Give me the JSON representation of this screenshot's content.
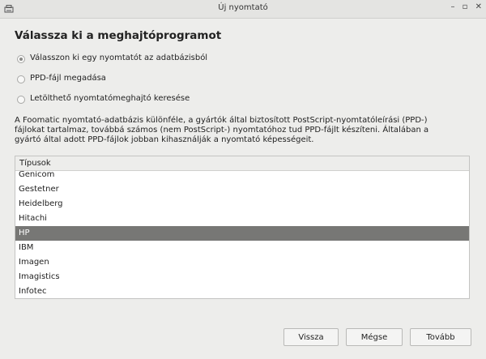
{
  "window": {
    "title": "Új nyomtató",
    "minimize": "–",
    "maximize": "▫",
    "close": "✕"
  },
  "page": {
    "heading": "Válassza ki a meghajtóprogramot"
  },
  "options": [
    {
      "label": "Válasszon ki egy nyomtatót az adatbázisból",
      "selected": true
    },
    {
      "label": "PPD-fájl megadása",
      "selected": false
    },
    {
      "label": "Letölthető nyomtatómeghajtó keresése",
      "selected": false
    }
  ],
  "description": {
    "line1": "A Foomatic nyomtató-adatbázis különféle, a gyártók által biztosított PostScript-nyomtatóleírási (PPD-)",
    "line2": "fájlokat tartalmaz, továbbá számos (nem PostScript-) nyomtatóhoz tud PPD-fájlt készíteni. Általában a",
    "line3": "gyártó által adott PPD-fájlok jobban kihasználják a nyomtató képességeit."
  },
  "list": {
    "header": "Típusok",
    "items": [
      "Genicom",
      "Gestetner",
      "Heidelberg",
      "Hitachi",
      "HP",
      "IBM",
      "Imagen",
      "Imagistics",
      "Infotec"
    ],
    "selected": "HP"
  },
  "buttons": {
    "back": "Vissza",
    "cancel": "Mégse",
    "next": "Tovább"
  },
  "colors": {
    "selection": "#777775",
    "window_bg": "#ededeb"
  }
}
